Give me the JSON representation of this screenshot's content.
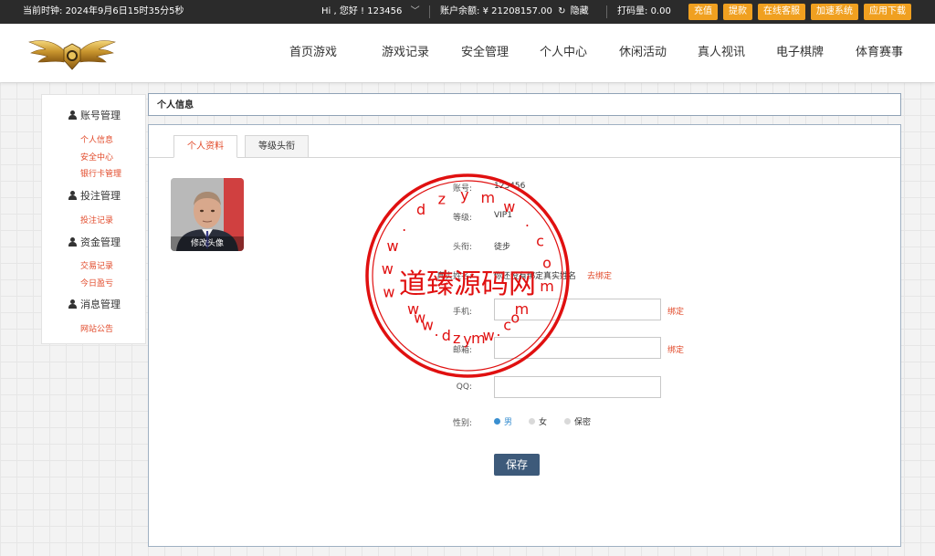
{
  "topbar": {
    "time_label": "当前时钟:",
    "time_value": "2024年9月6日15时35分5秒",
    "greeting": "Hi , 您好 !",
    "username": "123456",
    "balance_label": "账户余额:",
    "balance_value": "¥ 21208157.00",
    "hide_label": "隐藏",
    "code_label": "打码量:",
    "code_value": "0.00",
    "buttons": [
      "充值",
      "提款",
      "在线客服",
      "加速系统",
      "应用下载"
    ]
  },
  "nav": [
    "首页游戏",
    "游戏记录",
    "安全管理",
    "个人中心",
    "休闲活动",
    "真人视讯",
    "电子棋牌",
    "体育赛事"
  ],
  "sidebar": {
    "groups": [
      {
        "title": "账号管理",
        "links": [
          "个人信息",
          "安全中心",
          "银行卡管理"
        ]
      },
      {
        "title": "投注管理",
        "links": [
          "投注记录"
        ]
      },
      {
        "title": "资金管理",
        "links": [
          "交易记录",
          "今日盈亏"
        ]
      },
      {
        "title": "消息管理",
        "links": [
          "网站公告"
        ]
      }
    ]
  },
  "content": {
    "title": "个人信息",
    "tabs": [
      "个人资料",
      "等级头衔"
    ],
    "avatar_caption": "修改头像",
    "fields": {
      "account_label": "账号:",
      "account_value": "123456",
      "level_label": "等级:",
      "level_value": "VIP1",
      "rank_label": "头衔:",
      "rank_value": "徒步",
      "realname_label": "真实姓名:",
      "realname_value": "你还没有绑定真实姓名",
      "realname_link": "去绑定",
      "phone_label": "手机:",
      "phone_link": "绑定",
      "email_label": "邮箱:",
      "email_link": "绑定",
      "qq_label": "QQ:",
      "gender_label": "性别:",
      "gender_options": [
        "男",
        "女",
        "保密"
      ],
      "gender_selected": "男"
    },
    "save_label": "保存"
  },
  "watermark": {
    "title": "道臻源码网",
    "top_letters": [
      "w",
      "w",
      "w",
      ".",
      "d",
      "z",
      "y",
      "m",
      "w",
      ".",
      "c",
      "o",
      "m"
    ],
    "bottom_letters": [
      "w",
      "w",
      "w",
      ".",
      "d",
      "z",
      "y",
      "m",
      "w",
      ".",
      "c",
      "o",
      "m"
    ],
    "color": "#e01010"
  },
  "colors": {
    "accent": "#e24a2a",
    "topbar": "#2b2b2b",
    "button": "#f0a020",
    "save": "#3d5a7a",
    "selected": "#3a8fd0"
  }
}
